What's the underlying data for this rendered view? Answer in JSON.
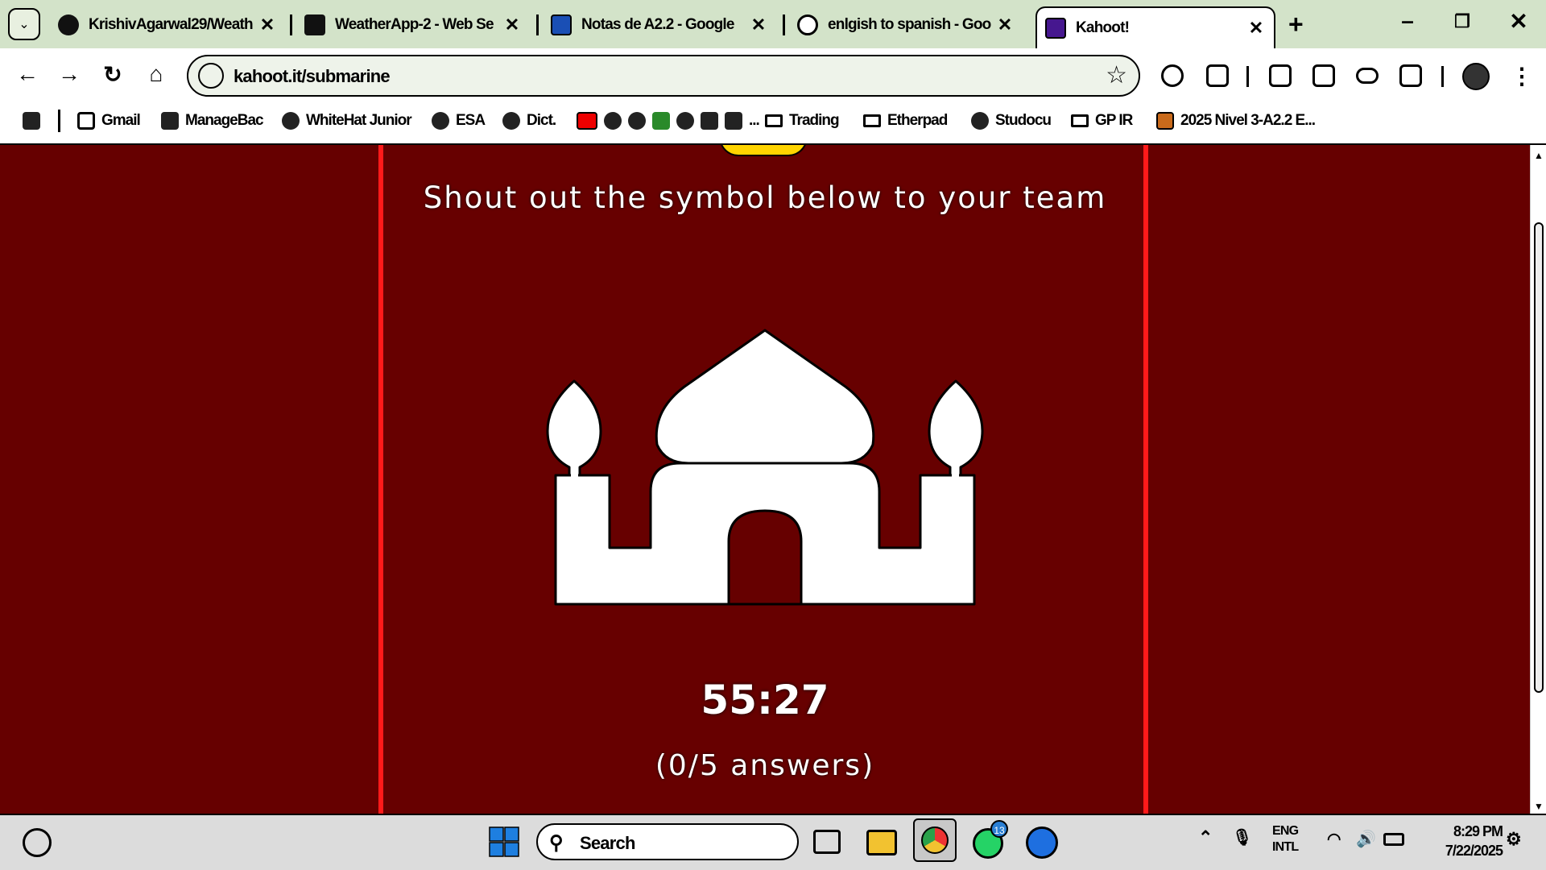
{
  "tabs": [
    {
      "title": "KrishivAgarwal29/Weath",
      "active": false
    },
    {
      "title": "WeatherApp-2 - Web Se",
      "active": false
    },
    {
      "title": "Notas de A2.2 - Google",
      "active": false
    },
    {
      "title": "enlgish to spanish - Goo",
      "active": false
    },
    {
      "title": "Kahoot!",
      "active": true
    }
  ],
  "tab_close_glyph": "✕",
  "new_tab_glyph": "+",
  "window_controls": {
    "minimize": "–",
    "restore": "❐",
    "close": "✕"
  },
  "nav": {
    "back": "←",
    "forward": "→",
    "reload": "↻",
    "home": "⌂"
  },
  "address_bar": {
    "url": "kahoot.it/submarine",
    "bookmark_glyph": "☆"
  },
  "bookmarks": [
    {
      "label": "",
      "icon": "apps-grid-icon"
    },
    {
      "label": "Gmail",
      "icon": "gmail-icon"
    },
    {
      "label": "ManageBac",
      "icon": "managebac-icon"
    },
    {
      "label": "WhiteHat Junior",
      "icon": "globe-icon"
    },
    {
      "label": "ESA",
      "icon": "globe-icon"
    },
    {
      "label": "Dict.",
      "icon": "globe-icon"
    },
    {
      "label": "...",
      "icon": "youtube-icon"
    },
    {
      "label": "Trading",
      "icon": "folder-icon"
    },
    {
      "label": "Etherpad",
      "icon": "folder-icon"
    },
    {
      "label": "Studocu",
      "icon": "globe-icon"
    },
    {
      "label": "GP IR",
      "icon": "folder-icon"
    },
    {
      "label": "2025 Nivel 3-A2.2 E...",
      "icon": "doc-icon"
    }
  ],
  "game": {
    "prompt": "Shout out the symbol below to your team",
    "symbol": "mosque-icon",
    "timer": "55:27",
    "answers": "(0/5 answers)",
    "colors": {
      "background": "#660000",
      "panel_border": "#ff1a1a",
      "accent_yellow": "#ffd400"
    }
  },
  "taskbar": {
    "search_label": "Search",
    "whatsapp_badge": "13",
    "language": {
      "line1": "ENG",
      "line2": "INTL"
    },
    "clock": {
      "time": "8:29 PM",
      "date": "7/22/2025"
    }
  }
}
